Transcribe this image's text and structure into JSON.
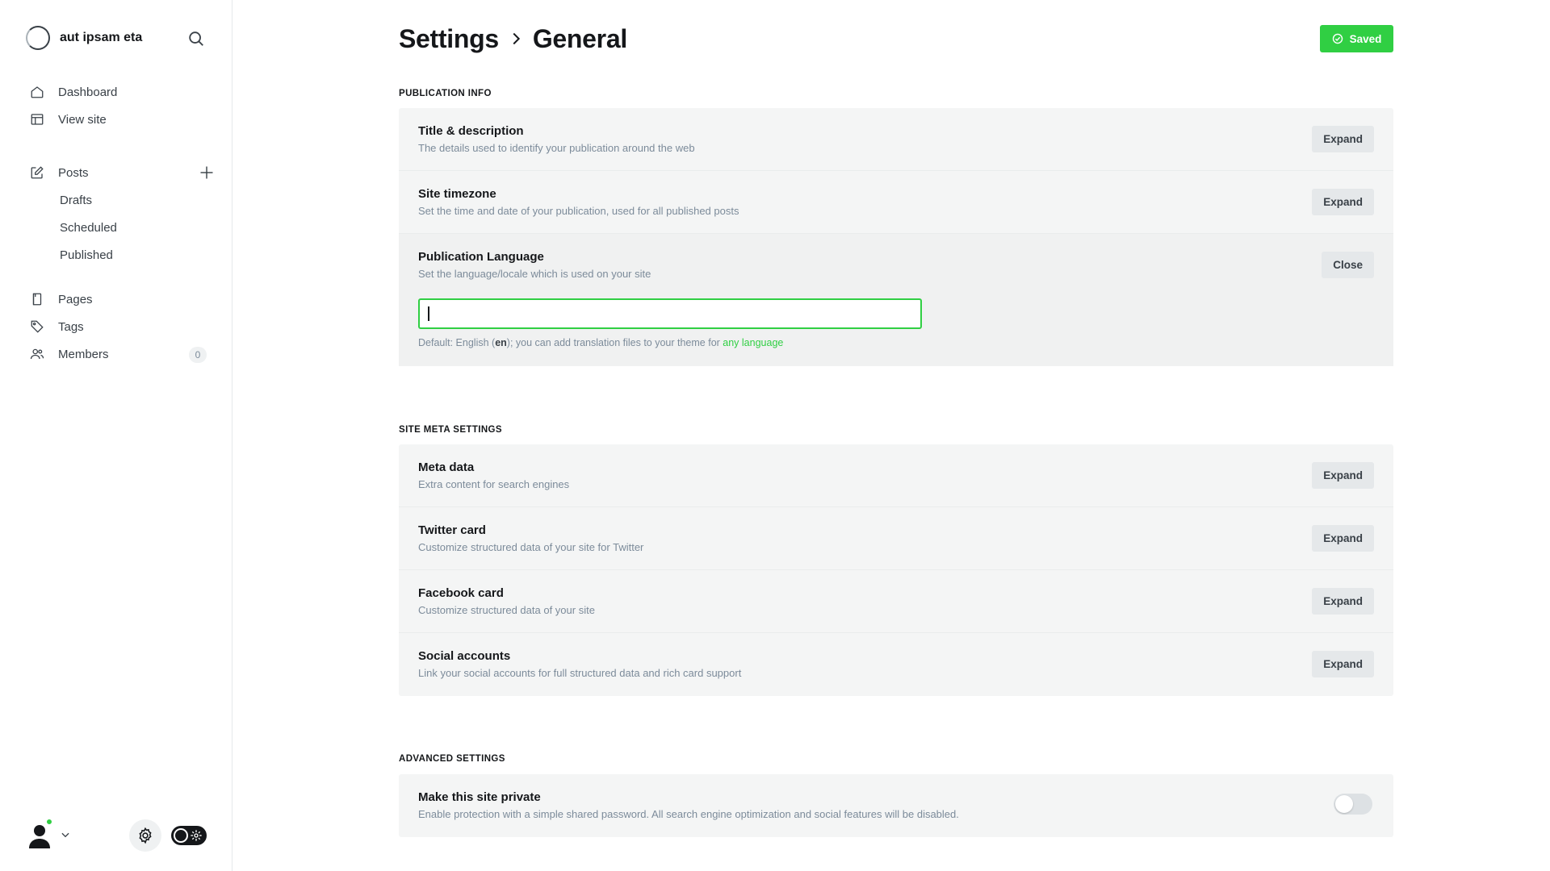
{
  "brand": {
    "name": "aut ipsam eta"
  },
  "nav": {
    "dashboard": "Dashboard",
    "view_site": "View site",
    "posts": "Posts",
    "drafts": "Drafts",
    "scheduled": "Scheduled",
    "published": "Published",
    "pages": "Pages",
    "tags": "Tags",
    "members": "Members",
    "members_count": "0"
  },
  "header": {
    "crumb_root": "Settings",
    "crumb_current": "General",
    "saved_label": "Saved"
  },
  "sections": {
    "publication_info": {
      "title": "Publication info",
      "rows": [
        {
          "title": "Title & description",
          "desc": "The details used to identify your publication around the web",
          "button": "Expand"
        },
        {
          "title": "Site timezone",
          "desc": "Set the time and date of your publication, used for all published posts",
          "button": "Expand"
        },
        {
          "title": "Publication Language",
          "desc": "Set the language/locale which is used on your site",
          "button": "Close"
        }
      ],
      "language_input_value": "",
      "language_hint_prefix": "Default: English (",
      "language_hint_code": "en",
      "language_hint_suffix": "); you can add translation files to your theme for ",
      "language_hint_link": "any language"
    },
    "site_meta": {
      "title": "Site meta settings",
      "rows": [
        {
          "title": "Meta data",
          "desc": "Extra content for search engines",
          "button": "Expand"
        },
        {
          "title": "Twitter card",
          "desc": "Customize structured data of your site for Twitter",
          "button": "Expand"
        },
        {
          "title": "Facebook card",
          "desc": "Customize structured data of your site",
          "button": "Expand"
        },
        {
          "title": "Social accounts",
          "desc": "Link your social accounts for full structured data and rich card support",
          "button": "Expand"
        }
      ]
    },
    "advanced": {
      "title": "Advanced settings",
      "private_title": "Make this site private",
      "private_desc": "Enable protection with a simple shared password. All search engine optimization and social features will be disabled.",
      "private_enabled": false
    }
  },
  "colors": {
    "accent": "#30cf43",
    "text": "#15171a",
    "muted": "#7c8b9a",
    "panel": "#f4f5f5"
  }
}
